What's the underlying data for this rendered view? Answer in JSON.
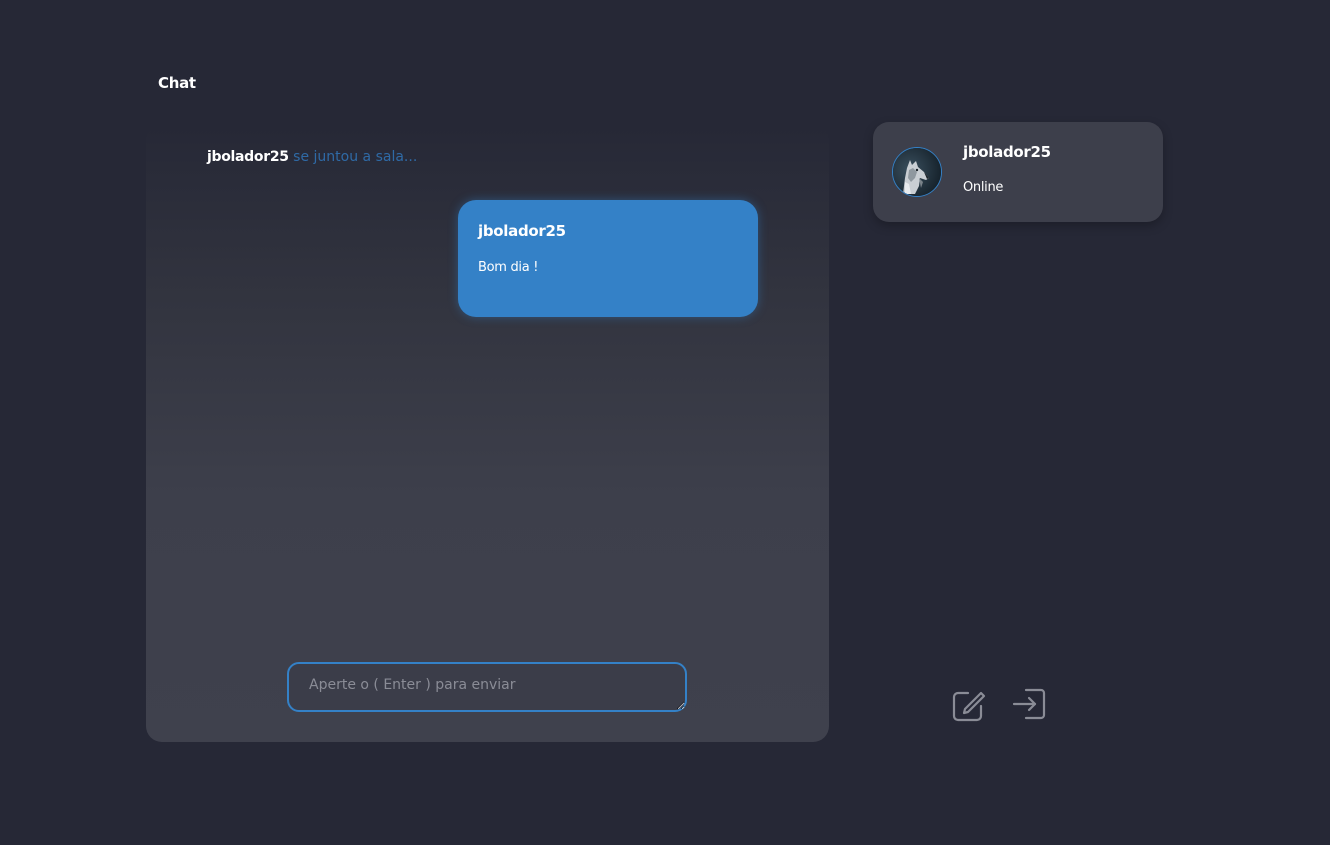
{
  "header": {
    "title": "Chat"
  },
  "chat": {
    "join_notice": {
      "user": "jbolador25",
      "text": "se juntou a sala..."
    },
    "messages": [
      {
        "author": "jbolador25",
        "text": "Bom dia !"
      }
    ],
    "input": {
      "placeholder": "Aperte o ( Enter ) para enviar",
      "value": ""
    }
  },
  "sidebar": {
    "user_card": {
      "name": "jbolador25",
      "status": "Online",
      "avatar_icon": "wolf-avatar"
    },
    "actions": [
      {
        "name": "edit",
        "icon": "edit-icon"
      },
      {
        "name": "logout",
        "icon": "logout-icon"
      }
    ]
  },
  "colors": {
    "background": "#262836",
    "panel": "#3d3f4b",
    "accent": "#3481c7",
    "join_text": "#2f6aa6"
  }
}
